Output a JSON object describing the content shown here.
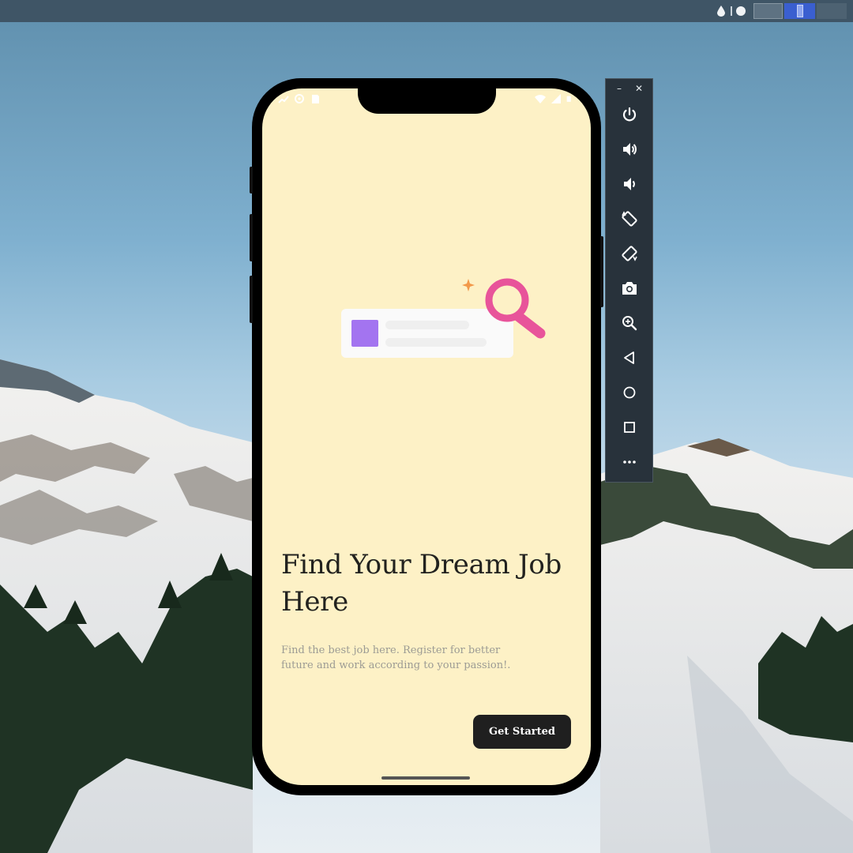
{
  "desktop": {
    "panel_color": "#3f5566",
    "workspaces": [
      "workspace-1",
      "workspace-2",
      "workspace-3"
    ],
    "active_workspace": 2
  },
  "phone": {
    "screen_color": "#fdf1c6",
    "status_bar": {
      "left_icons": [
        "signal-icon",
        "settings-icon",
        "sd-card-icon"
      ],
      "right_icons": [
        "wifi-icon",
        "cell-signal-icon",
        "battery-icon"
      ]
    },
    "onboarding": {
      "headline": "Find Your Dream Job Here",
      "description": "Find the best job here. Register for better future and work according to your passion!.",
      "cta_label": "Get Started"
    },
    "accent_colors": {
      "search_icon": "#e8549a",
      "card_thumbnail": "#a374f0",
      "sparkle": "#f2994a",
      "button": "#1f1f1f"
    }
  },
  "emulator_controls": {
    "window_buttons": [
      "–",
      "✕"
    ],
    "items": [
      {
        "name": "power-button",
        "icon": "power-icon"
      },
      {
        "name": "volume-up-button",
        "icon": "volume-up-icon"
      },
      {
        "name": "volume-down-button",
        "icon": "volume-down-icon"
      },
      {
        "name": "rotate-left-button",
        "icon": "rotate-left-icon"
      },
      {
        "name": "rotate-right-button",
        "icon": "rotate-right-icon"
      },
      {
        "name": "screenshot-button",
        "icon": "camera-icon"
      },
      {
        "name": "zoom-button",
        "icon": "zoom-in-icon"
      },
      {
        "name": "back-button",
        "icon": "back-triangle-icon"
      },
      {
        "name": "home-button",
        "icon": "home-circle-icon"
      },
      {
        "name": "overview-button",
        "icon": "overview-square-icon"
      },
      {
        "name": "more-button",
        "icon": "more-dots-icon"
      }
    ]
  }
}
